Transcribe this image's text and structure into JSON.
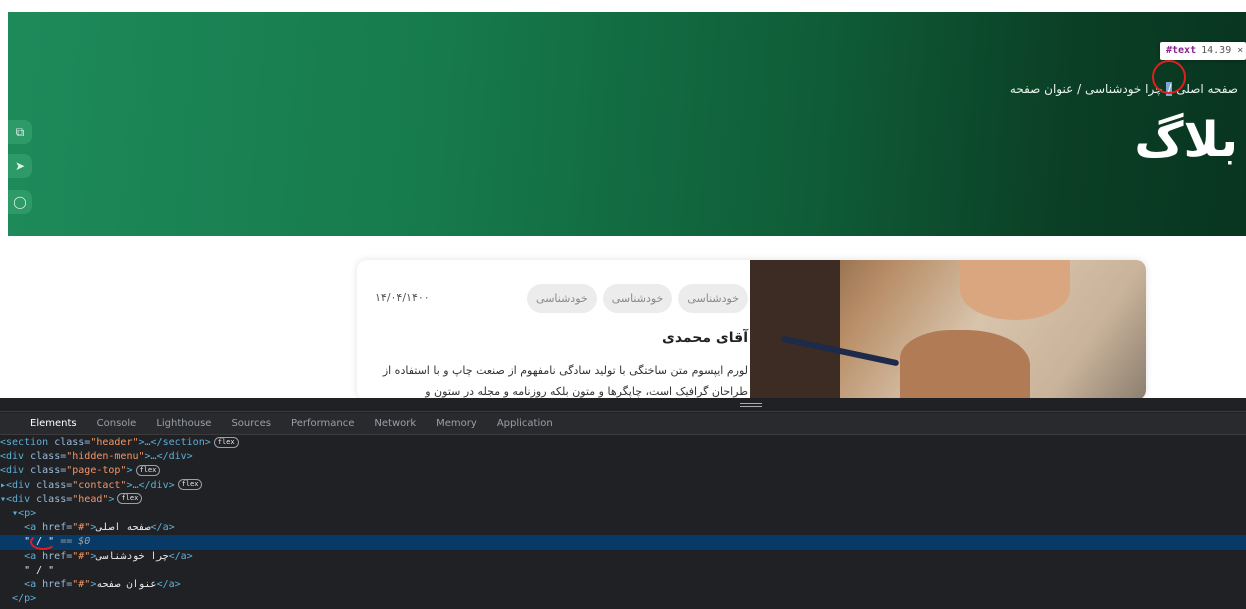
{
  "hero": {
    "breadcrumb": {
      "items": [
        "صفحه اصلی",
        "چرا خودشناسی",
        "عنوان صفحه"
      ],
      "separator": "/"
    },
    "title": "بلاگ",
    "tooltip": {
      "tag": "#text",
      "dims": "14.39 × 2"
    },
    "colors": {
      "start": "#1e8a5a",
      "end": "#083520"
    }
  },
  "side_buttons": [
    {
      "icon": "copy-icon",
      "glyph": "⧉"
    },
    {
      "icon": "telegram-icon",
      "glyph": "➤"
    },
    {
      "icon": "chat-icon",
      "glyph": "◯"
    }
  ],
  "card": {
    "tags": [
      "خودشناسی",
      "خودشناسی",
      "خودشناسی"
    ],
    "date": "۱۴/۰۴/۱۴۰۰",
    "author": "آقای محمدی",
    "excerpt": "لورم ایپسوم متن ساختگی با تولید سادگی نامفهوم از صنعت چاپ و با استفاده از طراحان گرافیک است، چاپگرها و متون بلکه روزنامه و مجله در ستون و"
  },
  "devtools": {
    "tabs": [
      "Elements",
      "Console",
      "Lighthouse",
      "Sources",
      "Performance",
      "Network",
      "Memory",
      "Application"
    ],
    "active_tab": "Elements",
    "badge": "flex",
    "lines": {
      "l1_tag_open": "<section",
      "l1_attr": " class=",
      "l1_val": "\"header\"",
      "l1_rest": ">…</section>",
      "l2_tag_open": "<div",
      "l2_attr": " class=",
      "l2_val": "\"hidden-menu\"",
      "l2_rest": ">…</div>",
      "l3_tag_open": "<div",
      "l3_attr": " class=",
      "l3_val": "\"page-top\"",
      "l3_rest": ">",
      "l4_tag_open": "▸<div",
      "l4_attr": " class=",
      "l4_val": "\"contact\"",
      "l4_rest": ">…</div>",
      "l5_tag_open": "▾<div",
      "l5_attr": " class=",
      "l5_val": "\"head\"",
      "l5_rest": ">",
      "l6": "  ▾<p>",
      "l7_open": "    <a",
      "l7_attr": " href=",
      "l7_val": "\"#\"",
      "l7_text": "صفحه اصلی",
      "l7_close": "</a>",
      "l8_text": "    \" / \"",
      "l8_eq": " == $0",
      "l9_open": "    <a",
      "l9_attr": " href=",
      "l9_val": "\"#\"",
      "l9_text": "چرا خودشناسی",
      "l9_close": "</a>",
      "l10_text": "    \" / \"",
      "l11_open": "    <a",
      "l11_attr": " href=",
      "l11_val": "\"#\"",
      "l11_text": "عنوان صفحه",
      "l11_close": "</a>",
      "l12": "  </p>"
    }
  }
}
